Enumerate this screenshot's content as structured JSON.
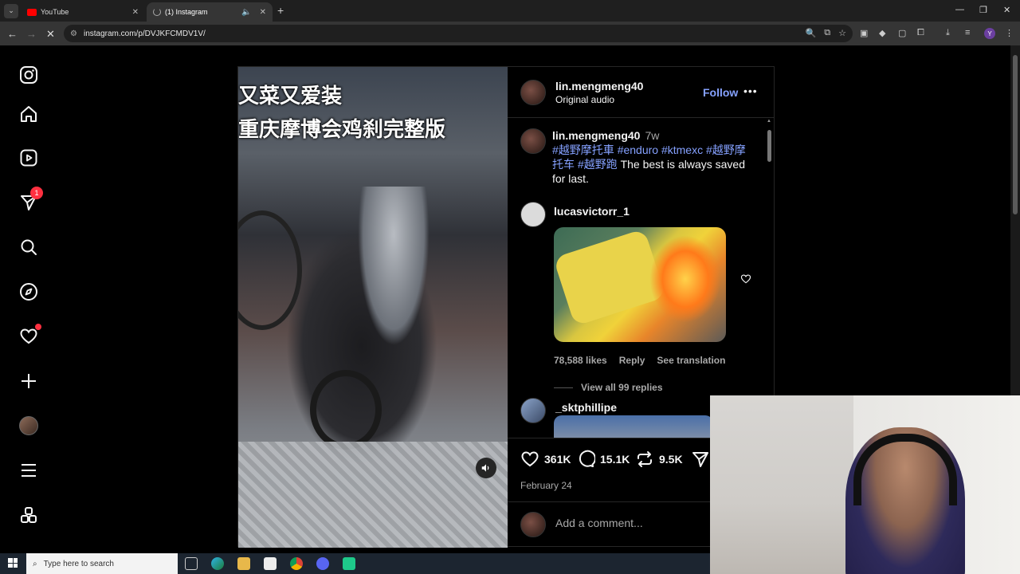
{
  "browser": {
    "tabs": [
      {
        "title": "YouTube"
      },
      {
        "title": "(1) Instagram"
      }
    ],
    "new_tab": "+",
    "url": "instagram.com/p/DVJKFCMDV1V/",
    "profile_initial": "Y"
  },
  "sidebar": {
    "notification_count": "1"
  },
  "post": {
    "video_caption_line1": "又菜又爱装",
    "video_caption_line2": "重庆摩博会鸡刹完整版",
    "author": "lin.mengmeng40",
    "audio": "Original audio",
    "follow_label": "Follow",
    "more_label": "•••",
    "caption": {
      "author": "lin.mengmeng40",
      "time": "7w",
      "hashtags": [
        "#越野摩托車",
        "#enduro",
        "#ktmexc",
        "#越野摩托车",
        "#越野跑"
      ],
      "text": "The best is always saved for last."
    },
    "comments": [
      {
        "author": "lucasvictorr_1",
        "likes": "78,588 likes",
        "reply": "Reply",
        "translate": "See translation",
        "view_replies": "View all 99 replies"
      },
      {
        "author": "_sktphillipe"
      }
    ],
    "stats": {
      "likes": "361K",
      "comments": "15.1K",
      "reposts": "9.5K"
    },
    "date": "February 24",
    "add_comment_placeholder": "Add a comment..."
  },
  "taskbar": {
    "search_placeholder": "Type here to search"
  },
  "colors": {
    "link_blue": "#85a1ff",
    "badge_red": "#ff3040",
    "background": "#000000"
  }
}
